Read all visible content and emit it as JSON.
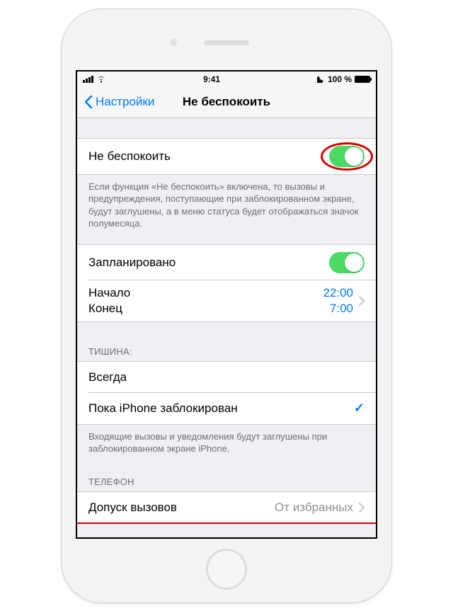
{
  "statusbar": {
    "time": "9:41",
    "battery_pct": "100 %"
  },
  "nav": {
    "back_label": "Настройки",
    "title": "Не беспокоить"
  },
  "dnd": {
    "toggle_label": "Не беспокоить",
    "footer": "Если функция «Не беспокоить» включена, то вызовы и предупреждения, поступающие при заблокированном экране, будут заглушены, а в меню статуса будет отображаться значок полумесяца."
  },
  "schedule": {
    "toggle_label": "Запланировано",
    "start_label": "Начало",
    "start_value": "22:00",
    "end_label": "Конец",
    "end_value": "7:00"
  },
  "silence": {
    "header": "ТИШИНА:",
    "always": "Всегда",
    "while_locked": "Пока iPhone заблокирован",
    "footer": "Входящие вызовы и уведомления будут заглушены при заблокированном экране iPhone."
  },
  "phone": {
    "header": "ТЕЛЕФОН",
    "allow_calls_label": "Допуск вызовов",
    "allow_calls_value": "От избранных"
  }
}
